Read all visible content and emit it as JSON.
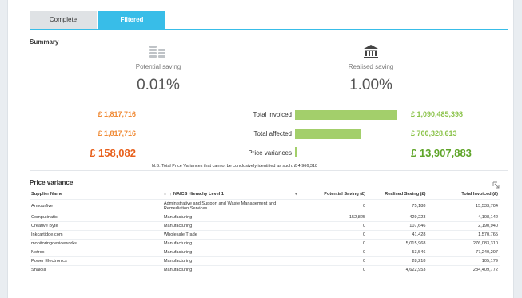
{
  "tabs": [
    {
      "label": "Complete"
    },
    {
      "label": "Filtered"
    }
  ],
  "summary": {
    "title": "Summary",
    "potential": {
      "label": "Potential saving",
      "value": "0.01%",
      "icon": "coins-icon"
    },
    "realised": {
      "label": "Realised saving",
      "value": "1.00%",
      "icon": "bank-icon"
    },
    "rows": [
      {
        "left": "£ 1,817,716",
        "label": "Total invoiced",
        "bar_fraction": 1.0,
        "right": "£ 1,090,485,398"
      },
      {
        "left": "£ 1,817,716",
        "label": "Total affected",
        "bar_fraction": 0.642,
        "right": "£ 700,328,613"
      },
      {
        "left": "£ 158,082",
        "label": "Price variances",
        "bar_fraction": 0.0128,
        "right": "£ 13,907,883"
      }
    ],
    "note": "N.B. Total Price Variances that cannot be conclusively identified as such: £ 4,966,318"
  },
  "colors": {
    "accent": "#38bde8",
    "orange": "#f08a35",
    "green": "#8bc34a",
    "bar": "#a3cf6b"
  },
  "price_variance": {
    "title": "Price variance",
    "columns": {
      "supplier": "Supplier Name",
      "naics": "NAICS Hierachy Level 1",
      "potential": "Potential Saving (£)",
      "realised": "Realised Saving (£)",
      "invoiced": "Total Invoiced (£)"
    },
    "rows": [
      {
        "supplier": "Armourfive",
        "naics": "Administrative and Support and Waste Management and Remediation Services",
        "potential": "0",
        "realised": "75,188",
        "invoiced": "15,533,704"
      },
      {
        "supplier": "Computinatic",
        "naics": "Manufacturing",
        "potential": "152,825",
        "realised": "429,223",
        "invoiced": "4,108,142"
      },
      {
        "supplier": "Creative Byte",
        "naics": "Manufacturing",
        "potential": "0",
        "realised": "107,646",
        "invoiced": "2,190,940"
      },
      {
        "supplier": "Inkcartidge.com",
        "naics": "Wholesale Trade",
        "potential": "0",
        "realised": "41,428",
        "invoiced": "1,570,765"
      },
      {
        "supplier": "monitoringdeviceworks",
        "naics": "Manufacturing",
        "potential": "0",
        "realised": "5,015,968",
        "invoiced": "276,083,310"
      },
      {
        "supplier": "Notrox",
        "naics": "Manufacturing",
        "potential": "0",
        "realised": "53,546",
        "invoiced": "77,240,207"
      },
      {
        "supplier": "Power Electronics",
        "naics": "Manufacturing",
        "potential": "0",
        "realised": "28,218",
        "invoiced": "105,179"
      },
      {
        "supplier": "Shalola",
        "naics": "Manufacturing",
        "potential": "0",
        "realised": "4,622,953",
        "invoiced": "284,409,772"
      }
    ]
  }
}
